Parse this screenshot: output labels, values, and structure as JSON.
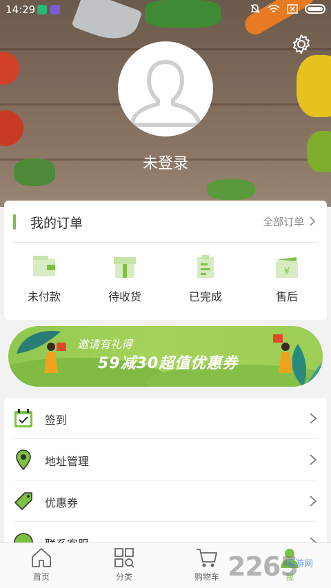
{
  "status": {
    "time": "14:29"
  },
  "profile": {
    "login_label": "未登录"
  },
  "orders": {
    "title": "我的订单",
    "all_label": "全部订单",
    "items": [
      {
        "label": "未付款",
        "icon": "wallet-icon"
      },
      {
        "label": "待收货",
        "icon": "package-icon"
      },
      {
        "label": "已完成",
        "icon": "clipboard-done-icon"
      },
      {
        "label": "售后",
        "icon": "yen-return-icon"
      }
    ]
  },
  "banner": {
    "line1": "邀请有礼得",
    "line2": "59减30超值优惠券"
  },
  "menu": [
    {
      "label": "签到",
      "icon": "calendar-check-icon"
    },
    {
      "label": "地址管理",
      "icon": "location-pin-icon"
    },
    {
      "label": "优惠券",
      "icon": "coupon-tag-icon"
    },
    {
      "label": "联系客服",
      "icon": "service-icon"
    }
  ],
  "tabs": [
    {
      "label": "首页",
      "icon": "home-icon"
    },
    {
      "label": "分类",
      "icon": "category-icon"
    },
    {
      "label": "购物车",
      "icon": "cart-icon"
    },
    {
      "label": "我",
      "icon": "user-icon"
    }
  ],
  "watermark": {
    "text": "2265",
    "sub": "手游网"
  },
  "colors": {
    "accent": "#7cc242",
    "banner": "#9ccd55"
  }
}
